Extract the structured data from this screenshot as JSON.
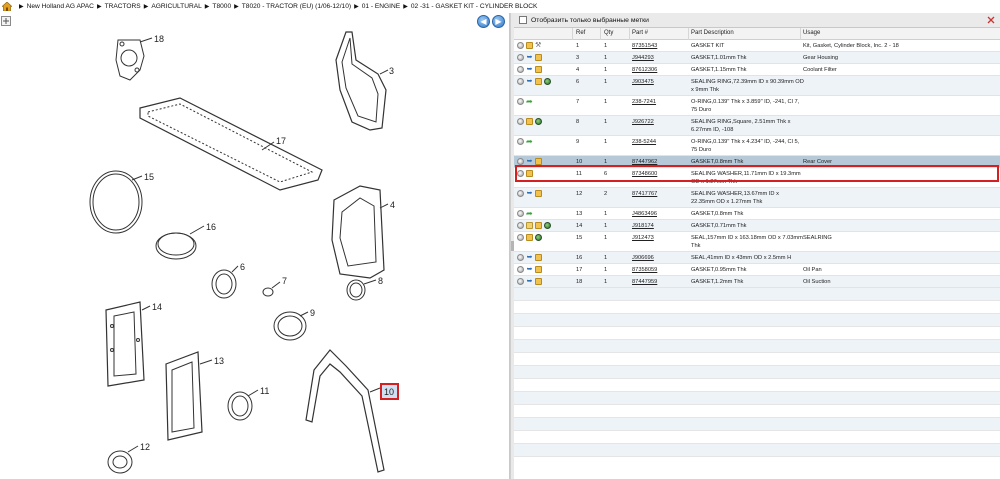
{
  "breadcrumb": [
    "New Holland AG APAC",
    "TRACTORS",
    "AGRICULTURAL",
    "T8000",
    "T8020 - TRACTOR (EU) (1/06-12/10)",
    "01 - ENGINE",
    "02 -31 - GASKET KIT - CYLINDER BLOCK"
  ],
  "filter": {
    "label": "Отобразить только выбранные метки"
  },
  "columns": {
    "ref": "Ref",
    "qty": "Qty",
    "part": "Part #",
    "desc": "Part Description",
    "usage": "Usage"
  },
  "rows": [
    {
      "ref": "1",
      "qty": "1",
      "part": "87351543",
      "desc": "GASKET KIT",
      "desc2": "",
      "usage": "Kit, Gasket, Cylinder Block, Inc. 2 - 18",
      "icons": [
        "gray",
        "box",
        "tool"
      ]
    },
    {
      "ref": "3",
      "qty": "1",
      "part": "J944293",
      "desc": "GASKET,1.01mm Thk",
      "desc2": "",
      "usage": "Gear Housing",
      "icons": [
        "gray",
        "blue",
        "box"
      ]
    },
    {
      "ref": "4",
      "qty": "1",
      "part": "87612306",
      "desc": "GASKET,1.15mm Thk",
      "desc2": "",
      "usage": "Coolant Filter",
      "icons": [
        "gray",
        "blue",
        "box"
      ]
    },
    {
      "ref": "6",
      "qty": "1",
      "part": "J903475",
      "desc": "SEALING RING,72.39mm ID x 90.39mm OD",
      "desc2": "x 9mm Thk",
      "usage": "",
      "icons": [
        "gray",
        "blue",
        "box",
        "globe"
      ]
    },
    {
      "ref": "7",
      "qty": "1",
      "part": "238-7241",
      "desc": "O-RING,0.139\" Thk x 3.859\" ID, -241, Cl 7,",
      "desc2": "75 Duro",
      "usage": "",
      "icons": [
        "gray",
        "green"
      ]
    },
    {
      "ref": "8",
      "qty": "1",
      "part": "J926722",
      "desc": "SEALING RING,Square, 2.51mm Thk x",
      "desc2": "6.27mm ID, -108",
      "usage": "",
      "icons": [
        "gray",
        "box",
        "globe"
      ]
    },
    {
      "ref": "9",
      "qty": "1",
      "part": "238-5244",
      "desc": "O-RING,0.139\" Thk x 4.234\" ID, -244, Cl 5,",
      "desc2": "75 Duro",
      "usage": "",
      "icons": [
        "gray",
        "green"
      ]
    },
    {
      "ref": "10",
      "qty": "1",
      "part": "87447962",
      "desc": "GASKET,0.8mm Thk",
      "desc2": "",
      "usage": "Rear Cover",
      "icons": [
        "gray",
        "blue",
        "box"
      ],
      "selected": true
    },
    {
      "ref": "11",
      "qty": "6",
      "part": "87348600",
      "desc": "SEALING WASHER,11.71mm ID x 19.3mm",
      "desc2": "OD x 1.27mm Thk",
      "usage": "",
      "icons": [
        "gray",
        "box"
      ]
    },
    {
      "ref": "12",
      "qty": "2",
      "part": "87417767",
      "desc": "SEALING WASHER,13.67mm ID x",
      "desc2": "22.35mm OD x 1.27mm Thk",
      "usage": "",
      "icons": [
        "gray",
        "blue",
        "box"
      ]
    },
    {
      "ref": "13",
      "qty": "1",
      "part": "J4863496",
      "desc": "GASKET,0.8mm Thk",
      "desc2": "",
      "usage": "",
      "icons": [
        "gray",
        "green"
      ]
    },
    {
      "ref": "14",
      "qty": "1",
      "part": "J918174",
      "desc": "GASKET,0.71mm Thk",
      "desc2": "",
      "usage": "",
      "icons": [
        "gray",
        "folder",
        "box",
        "globe"
      ]
    },
    {
      "ref": "15",
      "qty": "1",
      "part": "J912473",
      "desc": "SEAL,157mm ID x 163.18mm OD x 7.03mm",
      "desc2": "Thk",
      "usage": "SEALRING",
      "icons": [
        "gray",
        "box",
        "globe"
      ]
    },
    {
      "ref": "16",
      "qty": "1",
      "part": "J906696",
      "desc": "SEAL,41mm ID x 43mm OD x  2.5mm H",
      "desc2": "",
      "usage": "",
      "icons": [
        "gray",
        "blue",
        "box"
      ]
    },
    {
      "ref": "17",
      "qty": "1",
      "part": "87358059",
      "desc": "GASKET,0.95mm Thk",
      "desc2": "",
      "usage": "Oil Pan",
      "icons": [
        "gray",
        "blue",
        "box"
      ]
    },
    {
      "ref": "18",
      "qty": "1",
      "part": "87447959",
      "desc": "GASKET,1.2mm Thk",
      "desc2": "",
      "usage": "Oil Suction",
      "icons": [
        "gray",
        "blue",
        "box"
      ]
    }
  ],
  "callouts": [
    "18",
    "3",
    "17",
    "15",
    "4",
    "16",
    "6",
    "7",
    "8",
    "14",
    "9",
    "13",
    "11",
    "10",
    "12"
  ]
}
